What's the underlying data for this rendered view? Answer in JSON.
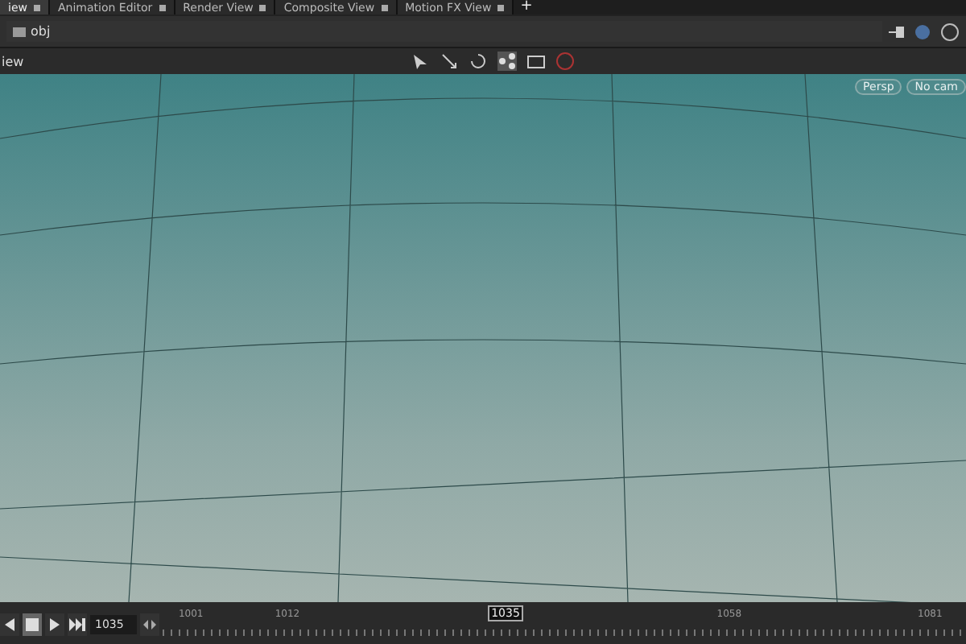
{
  "tabs": [
    {
      "label": "iew",
      "selected": true
    },
    {
      "label": "Animation Editor",
      "selected": false
    },
    {
      "label": "Render View",
      "selected": false
    },
    {
      "label": "Composite View",
      "selected": false
    },
    {
      "label": "Motion FX View",
      "selected": false
    }
  ],
  "path": "obj",
  "viewport": {
    "title": "iew",
    "camera": "Persp",
    "camera_menu": "No cam"
  },
  "add_tab": "+",
  "timeline": {
    "frame": "1035",
    "ticks": [
      {
        "label": "1001",
        "selected": false
      },
      {
        "label": "1012",
        "selected": false
      },
      {
        "label": "1035",
        "selected": true
      },
      {
        "label": "1058",
        "selected": false
      },
      {
        "label": "1081",
        "selected": false
      }
    ]
  }
}
